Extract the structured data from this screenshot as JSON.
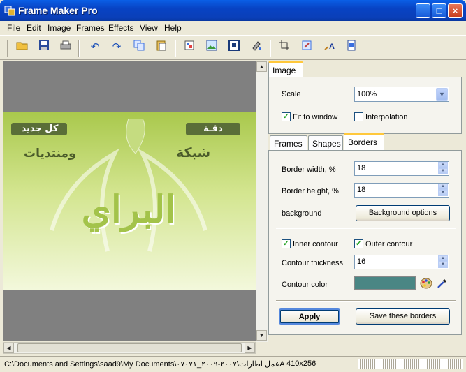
{
  "window": {
    "title": "Frame Maker Pro",
    "minimize": "_",
    "maximize": "□",
    "close": "×"
  },
  "menu": [
    "File",
    "Edit",
    "Image",
    "Frames",
    "Effects",
    "View",
    "Help"
  ],
  "toolbar": {
    "icons": [
      "open-folder-icon",
      "save-icon",
      "print-icon",
      "undo-icon",
      "redo-icon",
      "copy-icon",
      "paste-icon",
      "color-adjust-icon",
      "picture-icon",
      "frame-icon",
      "fill-icon",
      "crop-icon",
      "resize-icon",
      "text-icon",
      "page-icon"
    ]
  },
  "image": {
    "arabic_top_left": "كل جديد",
    "arabic_top_right": "دقـة",
    "arabic_mid_left": "ومنتديات",
    "arabic_mid_right": "شبكة",
    "arabic_logo": "البراي",
    "colors": {
      "bg_top": "#a9c84c",
      "bg_bottom": "#f3f8dc",
      "tag": "#5a6e38"
    }
  },
  "image_panel": {
    "tab": "Image",
    "scale_label": "Scale",
    "scale_value": "100%",
    "fit_label": "Fit to window",
    "fit_checked": true,
    "interp_label": "Interpolation",
    "interp_checked": false
  },
  "tabs": [
    "Frames",
    "Shapes",
    "Borders"
  ],
  "active_tab": "Borders",
  "borders": {
    "border_width_label": "Border width, %",
    "border_width_value": "18",
    "border_height_label": "Border height, %",
    "border_height_value": "18",
    "background_label": "background",
    "background_button": "Background options",
    "inner_contour_label": "Inner contour",
    "inner_checked": true,
    "outer_contour_label": "Outer contour",
    "outer_checked": true,
    "contour_thickness_label": "Contour thickness",
    "contour_thickness_value": "16",
    "contour_color_label": "Contour color",
    "contour_color": "#4a8684",
    "apply_button": "Apply",
    "save_button": "Save these borders"
  },
  "status": {
    "path": "C:\\Documents and Settings\\saad9\\My Documents\\عمل اطارات\\٢٠٠٧-٢٠٠٩_٠٧٠٧١A",
    "dimensions": "410x256"
  }
}
